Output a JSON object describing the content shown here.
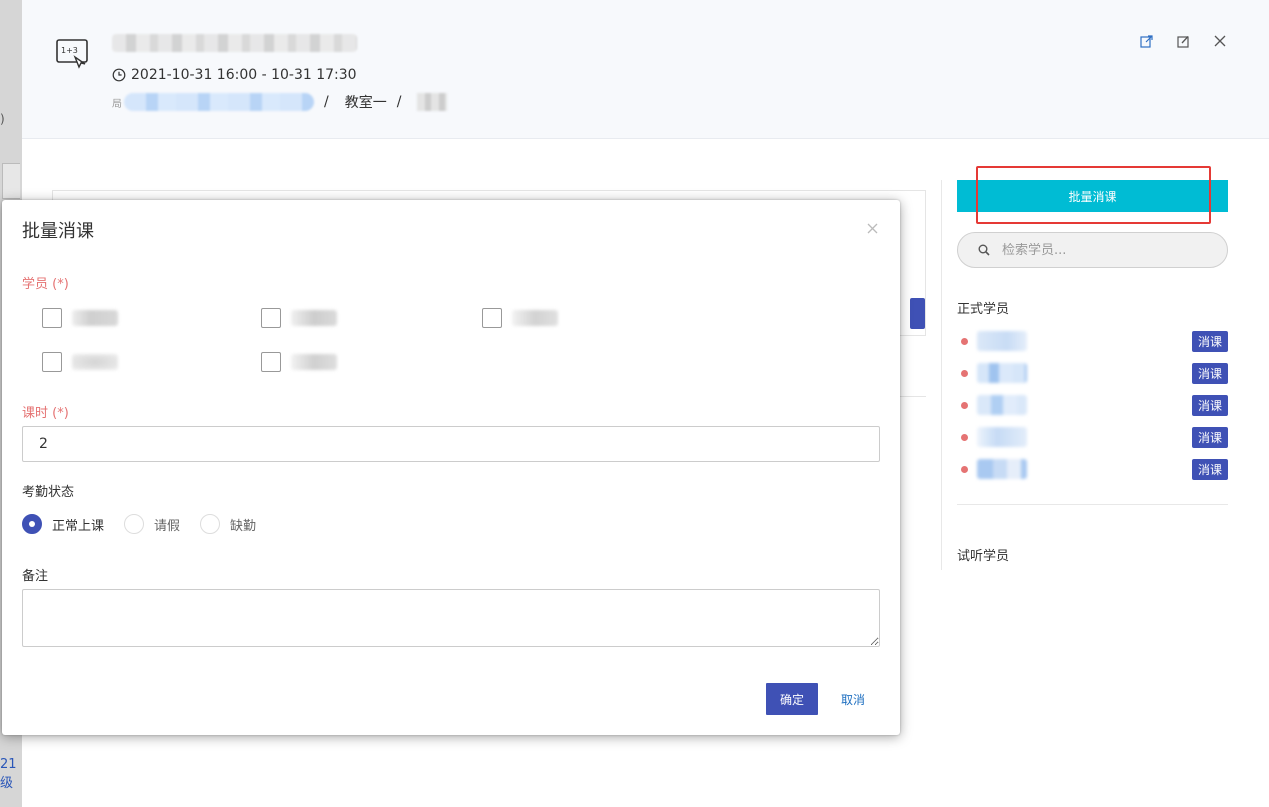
{
  "background": {
    "paren_fragment": ")",
    "link_fragment": "21级"
  },
  "header": {
    "time_range": "2021-10-31 16:00 - 10-31 17:30",
    "location_prefix": "局",
    "separator": "/",
    "classroom": "教室一",
    "icons": [
      "export-icon",
      "edit-icon",
      "close-icon"
    ]
  },
  "side_panel": {
    "batch_button_label": "批量消课",
    "search_placeholder": "检索学员...",
    "formal_students_label": "正式学员",
    "students": [
      {
        "action_label": "消课"
      },
      {
        "action_label": "消课"
      },
      {
        "action_label": "消课"
      },
      {
        "action_label": "消课"
      },
      {
        "action_label": "消课"
      }
    ],
    "trial_students_label": "试听学员",
    "colors": {
      "batch_button": "#00bcd4",
      "action_button": "#3f51b5",
      "status_dot": "#e57373",
      "highlight_box": "#e53935"
    }
  },
  "modal": {
    "title": "批量消课",
    "students_label": "学员 (*)",
    "hours_label": "课时 (*)",
    "hours_value": "2",
    "attendance_label": "考勤状态",
    "attendance_options": [
      "正常上课",
      "请假",
      "缺勤"
    ],
    "attendance_selected": "正常上课",
    "remark_label": "备注",
    "remark_value": "",
    "confirm_label": "确定",
    "cancel_label": "取消",
    "required_color": "#e57373"
  }
}
